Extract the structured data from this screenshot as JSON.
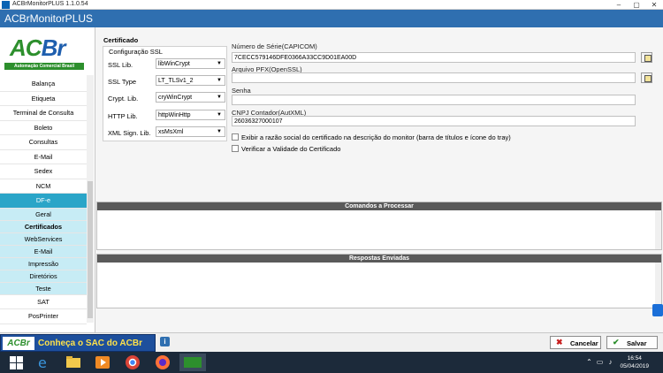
{
  "window": {
    "title": "ACBrMonitorPLUS 1.1.0.54",
    "controls": [
      "–",
      "▢",
      "✕"
    ]
  },
  "header": {
    "title": "ACBrMonitorPLUS"
  },
  "logo": {
    "text_ac": "AC",
    "text_br": "Br",
    "tagline": "Automação Comercial Brasil"
  },
  "sidebar": {
    "items": [
      "Balança",
      "Etiqueta",
      "Terminal de Consulta",
      "Boleto",
      "Consultas",
      "E-Mail",
      "Sedex",
      "NCM",
      "DF-e"
    ],
    "subitems": [
      "Geral",
      "Certificados",
      "WebServices",
      "E-Mail",
      "Impressão",
      "Diretórios",
      "Teste"
    ],
    "after_items": [
      "SAT",
      "PosPrinter"
    ]
  },
  "cert": {
    "group_title": "Certificado",
    "ssl_title": "Configuração SSL",
    "ssl": [
      {
        "label": "SSL Lib.",
        "value": "libWinCrypt"
      },
      {
        "label": "SSL Type",
        "value": "LT_TLSv1_2"
      },
      {
        "label": "Crypt. Lib.",
        "value": "cryWinCrypt"
      },
      {
        "label": "HTTP Lib.",
        "value": "httpWinHttp"
      },
      {
        "label": "XML Sign. Lib.",
        "value": "xsMsXml"
      }
    ],
    "serial_label": "Número de Série(CAPICOM)",
    "serial_value": "7CECC579146DFE0366A33CC9D01EA00D",
    "pfx_label": "Arquivo PFX(OpenSSL)",
    "pfx_value": "",
    "senha_label": "Senha",
    "senha_value": "",
    "cnpj_label": "CNPJ Contador(AutXML)",
    "cnpj_value": "26036327000107",
    "chk1": "Exibir a razão social do certificado na descrição do monitor (barra de títulos e ícone do tray)",
    "chk2": "Verificar a Validade do Certificado"
  },
  "panels": {
    "commands": "Comandos a Processar",
    "responses": "Respostas Enviadas"
  },
  "footer": {
    "sac": "Conheça o SAC do ACBr",
    "sac_logo": "ACBr",
    "info": "i",
    "cancel": "Cancelar",
    "save": "Salvar"
  },
  "taskbar": {
    "time": "16:54",
    "date": "05/04/2019"
  },
  "colors": {
    "header": "#2f6fb0",
    "active_nav": "#2aa5c8",
    "sub_nav": "#c7ecf5"
  }
}
